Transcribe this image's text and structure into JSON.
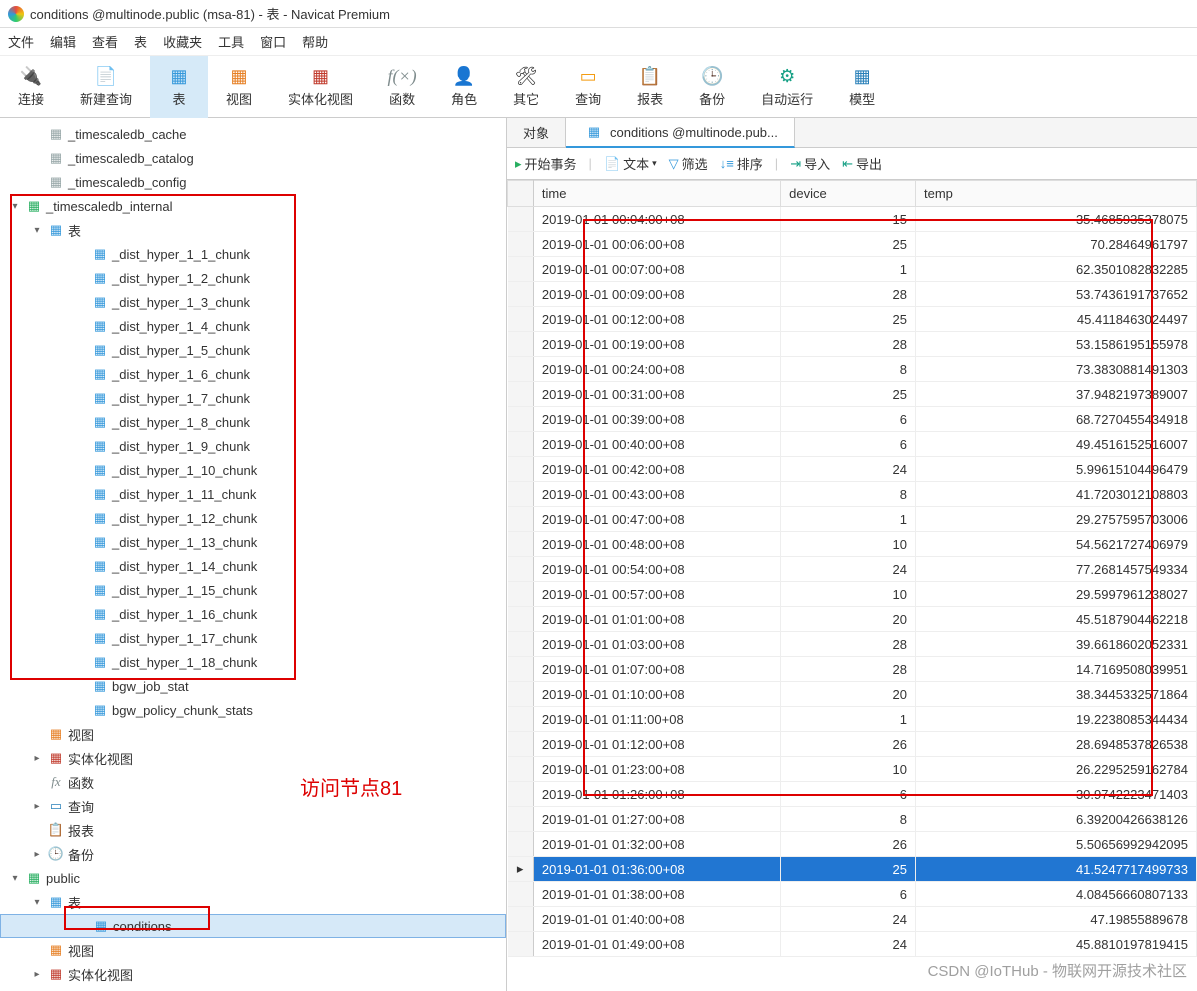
{
  "window": {
    "title": "conditions @multinode.public (msa-81) - 表 - Navicat Premium"
  },
  "menu": {
    "file": "文件",
    "edit": "编辑",
    "view": "查看",
    "table": "表",
    "favorites": "收藏夹",
    "tools": "工具",
    "window": "窗口",
    "help": "帮助"
  },
  "toolbar": {
    "connect": "连接",
    "newquery": "新建查询",
    "table": "表",
    "view": "视图",
    "matview": "实体化视图",
    "function": "函数",
    "role": "角色",
    "other": "其它",
    "query": "查询",
    "report": "报表",
    "backup": "备份",
    "autorun": "自动运行",
    "model": "模型"
  },
  "tree": {
    "schemas": [
      {
        "name": "_timescaledb_cache",
        "type": "schema2"
      },
      {
        "name": "_timescaledb_catalog",
        "type": "schema2"
      },
      {
        "name": "_timescaledb_config",
        "type": "schema2"
      }
    ],
    "internal": {
      "name": "_timescaledb_internal",
      "tables_label": "表",
      "chunks": [
        "_dist_hyper_1_1_chunk",
        "_dist_hyper_1_2_chunk",
        "_dist_hyper_1_3_chunk",
        "_dist_hyper_1_4_chunk",
        "_dist_hyper_1_5_chunk",
        "_dist_hyper_1_6_chunk",
        "_dist_hyper_1_7_chunk",
        "_dist_hyper_1_8_chunk",
        "_dist_hyper_1_9_chunk",
        "_dist_hyper_1_10_chunk",
        "_dist_hyper_1_11_chunk",
        "_dist_hyper_1_12_chunk",
        "_dist_hyper_1_13_chunk",
        "_dist_hyper_1_14_chunk",
        "_dist_hyper_1_15_chunk",
        "_dist_hyper_1_16_chunk",
        "_dist_hyper_1_17_chunk",
        "_dist_hyper_1_18_chunk"
      ],
      "extra": [
        "bgw_job_stat",
        "bgw_policy_chunk_stats"
      ]
    },
    "cats": {
      "view": "视图",
      "matview": "实体化视图",
      "fx": "函数",
      "query": "查询",
      "report": "报表",
      "backup": "备份"
    },
    "public": {
      "name": "public",
      "tables_label": "表",
      "table": "conditions",
      "view": "视图",
      "matview": "实体化视图"
    }
  },
  "annotation": "访问节点81",
  "tabs": {
    "objects": "对象",
    "conditions": "conditions @multinode.pub..."
  },
  "actions": {
    "begin": "开始事务",
    "text": "文本",
    "filter": "筛选",
    "sort": "排序",
    "import": "导入",
    "export": "导出"
  },
  "columns": {
    "time": "time",
    "device": "device",
    "temp": "temp"
  },
  "rows": [
    {
      "time": "2019-01-01 00:04:00+08",
      "device": "15",
      "temp": "35.4685935378075"
    },
    {
      "time": "2019-01-01 00:06:00+08",
      "device": "25",
      "temp": "70.28464961797"
    },
    {
      "time": "2019-01-01 00:07:00+08",
      "device": "1",
      "temp": "62.3501082832285"
    },
    {
      "time": "2019-01-01 00:09:00+08",
      "device": "28",
      "temp": "53.7436191737652"
    },
    {
      "time": "2019-01-01 00:12:00+08",
      "device": "25",
      "temp": "45.4118463024497"
    },
    {
      "time": "2019-01-01 00:19:00+08",
      "device": "28",
      "temp": "53.1586195155978"
    },
    {
      "time": "2019-01-01 00:24:00+08",
      "device": "8",
      "temp": "73.3830881491303"
    },
    {
      "time": "2019-01-01 00:31:00+08",
      "device": "25",
      "temp": "37.9482197389007"
    },
    {
      "time": "2019-01-01 00:39:00+08",
      "device": "6",
      "temp": "68.7270455434918"
    },
    {
      "time": "2019-01-01 00:40:00+08",
      "device": "6",
      "temp": "49.4516152516007"
    },
    {
      "time": "2019-01-01 00:42:00+08",
      "device": "24",
      "temp": "5.99615104496479"
    },
    {
      "time": "2019-01-01 00:43:00+08",
      "device": "8",
      "temp": "41.7203012108803"
    },
    {
      "time": "2019-01-01 00:47:00+08",
      "device": "1",
      "temp": "29.2757595703006"
    },
    {
      "time": "2019-01-01 00:48:00+08",
      "device": "10",
      "temp": "54.5621727406979"
    },
    {
      "time": "2019-01-01 00:54:00+08",
      "device": "24",
      "temp": "77.2681457549334"
    },
    {
      "time": "2019-01-01 00:57:00+08",
      "device": "10",
      "temp": "29.5997961238027"
    },
    {
      "time": "2019-01-01 01:01:00+08",
      "device": "20",
      "temp": "45.5187904462218"
    },
    {
      "time": "2019-01-01 01:03:00+08",
      "device": "28",
      "temp": "39.6618602052331"
    },
    {
      "time": "2019-01-01 01:07:00+08",
      "device": "28",
      "temp": "14.7169508039951"
    },
    {
      "time": "2019-01-01 01:10:00+08",
      "device": "20",
      "temp": "38.3445332571864"
    },
    {
      "time": "2019-01-01 01:11:00+08",
      "device": "1",
      "temp": "19.2238085344434"
    },
    {
      "time": "2019-01-01 01:12:00+08",
      "device": "26",
      "temp": "28.6948537826538"
    },
    {
      "time": "2019-01-01 01:23:00+08",
      "device": "10",
      "temp": "26.2295259162784"
    },
    {
      "time": "2019-01-01 01:26:00+08",
      "device": "6",
      "temp": "30.9742223471403"
    },
    {
      "time": "2019-01-01 01:27:00+08",
      "device": "8",
      "temp": "6.39200426638126"
    },
    {
      "time": "2019-01-01 01:32:00+08",
      "device": "26",
      "temp": "5.50656992942095"
    },
    {
      "time": "2019-01-01 01:36:00+08",
      "device": "25",
      "temp": "41.5247717499733",
      "selected": true
    },
    {
      "time": "2019-01-01 01:38:00+08",
      "device": "6",
      "temp": "4.08456660807133"
    },
    {
      "time": "2019-01-01 01:40:00+08",
      "device": "24",
      "temp": "47.19855889678"
    },
    {
      "time": "2019-01-01 01:49:00+08",
      "device": "24",
      "temp": "45.8810197819415"
    }
  ],
  "watermark": "CSDN @IoTHub - 物联网开源技术社区"
}
